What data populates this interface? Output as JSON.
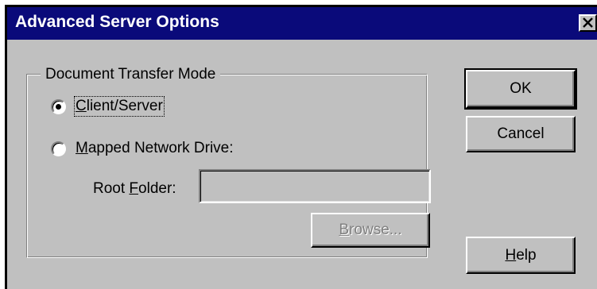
{
  "window": {
    "title": "Advanced Server Options"
  },
  "group": {
    "label": "Document Transfer Mode",
    "options": [
      {
        "label": "Client/Server",
        "selected": true
      },
      {
        "label": "Mapped Network Drive:",
        "selected": false
      }
    ],
    "root_folder": {
      "label": "Root Folder:",
      "value": ""
    },
    "browse_label": "Browse..."
  },
  "buttons": {
    "ok": "OK",
    "cancel": "Cancel",
    "help": "Help"
  },
  "colors": {
    "titlebar": "#0a0a7a",
    "face": "#c0c0c0",
    "disabled_text": "#808080"
  },
  "icons": {
    "close": "close-icon"
  }
}
